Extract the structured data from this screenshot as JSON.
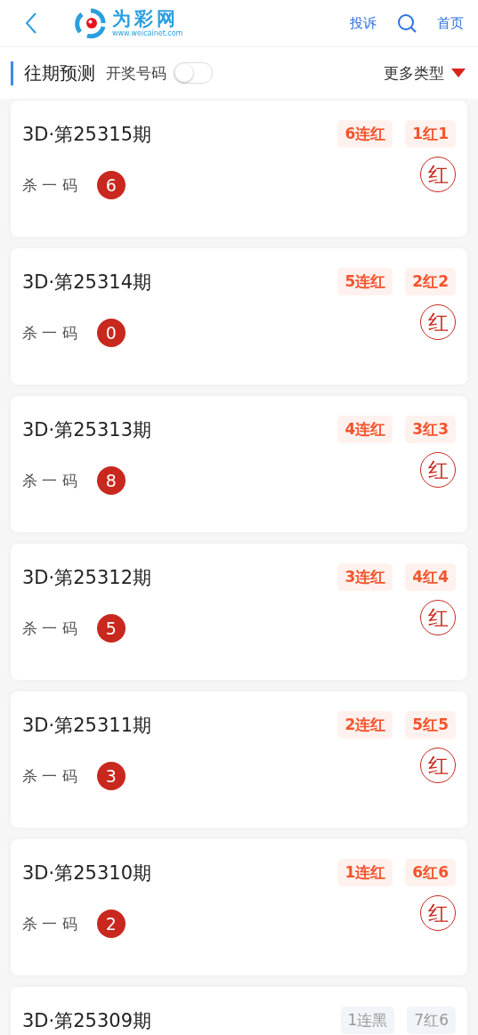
{
  "header": {
    "logo_name": "为彩网",
    "logo_url": "www.weicainet.com",
    "complaint": "投诉",
    "home": "首页"
  },
  "section": {
    "title": "往期预测",
    "toggle_label": "开奖号码",
    "toggle_on": false,
    "more": "更多类型"
  },
  "cards": [
    {
      "title": "3D·第25315期",
      "hit": true,
      "tags": [
        "6连红",
        "1红1"
      ],
      "label": "杀 一 码",
      "number": "6",
      "result": "红"
    },
    {
      "title": "3D·第25314期",
      "hit": true,
      "tags": [
        "5连红",
        "2红2"
      ],
      "label": "杀 一 码",
      "number": "0",
      "result": "红"
    },
    {
      "title": "3D·第25313期",
      "hit": true,
      "tags": [
        "4连红",
        "3红3"
      ],
      "label": "杀 一 码",
      "number": "8",
      "result": "红"
    },
    {
      "title": "3D·第25312期",
      "hit": true,
      "tags": [
        "3连红",
        "4红4"
      ],
      "label": "杀 一 码",
      "number": "5",
      "result": "红"
    },
    {
      "title": "3D·第25311期",
      "hit": true,
      "tags": [
        "2连红",
        "5红5"
      ],
      "label": "杀 一 码",
      "number": "3",
      "result": "红"
    },
    {
      "title": "3D·第25310期",
      "hit": true,
      "tags": [
        "1连红",
        "6红6"
      ],
      "label": "杀 一 码",
      "number": "2",
      "result": "红"
    },
    {
      "title": "3D·第25309期",
      "hit": false,
      "tags": [
        "1连黑",
        "7红6"
      ]
    }
  ]
}
